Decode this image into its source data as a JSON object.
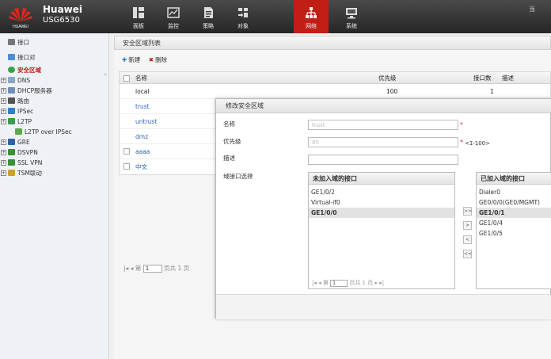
{
  "header": {
    "brand_name": "Huawei",
    "model": "USG6530",
    "logo_text": "HUAWEI",
    "corner_text": "当",
    "nav": [
      {
        "label": "面板",
        "icon": "dashboard-icon"
      },
      {
        "label": "监控",
        "icon": "monitor-icon"
      },
      {
        "label": "策略",
        "icon": "policy-icon"
      },
      {
        "label": "对象",
        "icon": "object-icon"
      },
      {
        "label": "网络",
        "icon": "network-icon",
        "active": true
      },
      {
        "label": "系统",
        "icon": "system-icon"
      }
    ],
    "active_color": "#c11f16"
  },
  "sidebar": {
    "items": [
      {
        "label": "接口",
        "icon": "interface-icon"
      },
      {
        "label": "接口对",
        "icon": "interface-pair-icon"
      },
      {
        "label": "安全区域",
        "icon": "security-zone-icon",
        "selected": true
      },
      {
        "label": "DNS",
        "icon": "dns-icon"
      },
      {
        "label": "DHCP服务器",
        "icon": "dhcp-icon"
      },
      {
        "label": "路由",
        "icon": "route-icon"
      },
      {
        "label": "IPSec",
        "icon": "ipsec-icon"
      },
      {
        "label": "L2TP",
        "icon": "l2tp-icon"
      },
      {
        "label": "L2TP over IPSec",
        "icon": "l2tp-ipsec-icon"
      },
      {
        "label": "GRE",
        "icon": "gre-icon"
      },
      {
        "label": "DSVPN",
        "icon": "dsvpn-icon"
      },
      {
        "label": "SSL VPN",
        "icon": "sslvpn-icon"
      },
      {
        "label": "TSM联动",
        "icon": "tsm-icon"
      }
    ]
  },
  "main": {
    "title": "安全区域列表",
    "toolbar": {
      "new_label": "新建",
      "delete_label": "删除"
    },
    "columns": {
      "name": "名称",
      "priority": "优先级",
      "if_count": "接口数",
      "desc": "描述"
    },
    "rows": [
      {
        "name": "local",
        "priority": "100",
        "if_count": "1"
      },
      {
        "name": "trust",
        "priority": "",
        "if_count": ""
      },
      {
        "name": "untrust",
        "priority": "",
        "if_count": ""
      },
      {
        "name": "dmz",
        "priority": "",
        "if_count": ""
      },
      {
        "name": "aaaa",
        "priority": "",
        "if_count": ""
      },
      {
        "name": "中文",
        "priority": "",
        "if_count": ""
      }
    ],
    "pager": {
      "page_prefix": "第",
      "page_value": "1",
      "page_suffix": "页共 1 页"
    }
  },
  "dialog": {
    "title": "修改安全区域",
    "name_label": "名称",
    "name_value": "trust",
    "priority_label": "优先级",
    "priority_value": "85",
    "priority_hint": "<1-100>",
    "desc_label": "描述",
    "desc_value": "",
    "ports_label": "域接口选择",
    "unassigned": {
      "header": "未加入域的接口",
      "items": [
        "GE1/0/2",
        "Virtual-if0",
        "GE1/0/0"
      ],
      "selected_index": 2
    },
    "assigned": {
      "header": "已加入域的接口",
      "items": [
        "Dialer0",
        "GE0/0/0(GE0/MGMT)",
        "GE1/0/1",
        "GE1/0/4",
        "GE1/0/5"
      ],
      "selected_index": 2
    },
    "move_buttons": [
      ">>",
      ">",
      "<",
      "<<"
    ],
    "pager": {
      "page_prefix": "第",
      "page_value": "1",
      "page_suffix": "页共 1 页"
    }
  }
}
